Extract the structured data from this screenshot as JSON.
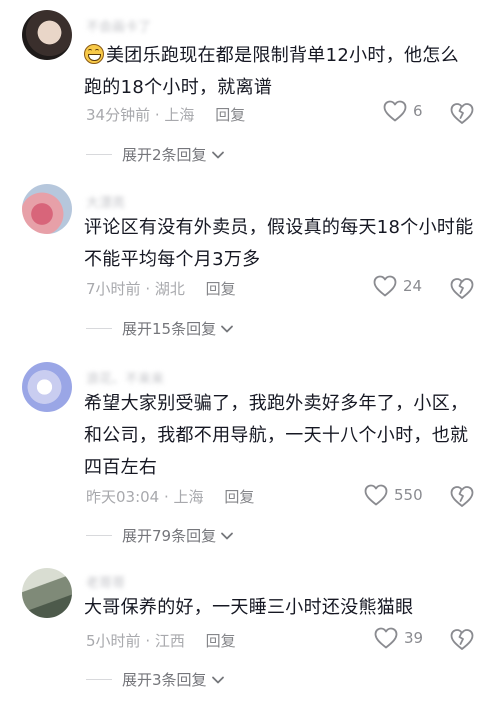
{
  "comments": [
    {
      "username": "不会画卡了",
      "has_emoji": true,
      "text_line1": "美团乐跑现在都是限制背单12小时，他怎么",
      "text_line2": "跑的18个小时，就离谱",
      "text_line3": "",
      "time": "34分钟前",
      "location": "上海",
      "reply_label": "回复",
      "likes": "6",
      "expand_label": "展开2条回复"
    },
    {
      "username": "大漂亮",
      "has_emoji": false,
      "text_line1": "评论区有没有外卖员，假设真的每天18个小时能",
      "text_line2": "不能平均每个月3万多",
      "text_line3": "",
      "time": "7小时前",
      "location": "湖北",
      "reply_label": "回复",
      "likes": "24",
      "expand_label": "展开15条回复"
    },
    {
      "username": "浪花、不来来",
      "has_emoji": false,
      "text_line1": "希望大家别受骗了，我跑外卖好多年了，小区，",
      "text_line2": "和公司，我都不用导航，一天十八个小时，也就",
      "text_line3": "四百左右",
      "time": "昨天03:04",
      "location": "上海",
      "reply_label": "回复",
      "likes": "550",
      "expand_label": "展开79条回复"
    },
    {
      "username": "老哥哥",
      "has_emoji": false,
      "text_line1": "大哥保养的好，一天睡三小时还没熊猫眼",
      "text_line2": "",
      "text_line3": "",
      "time": "5小时前",
      "location": "江西",
      "reply_label": "回复",
      "likes": "39",
      "expand_label": "展开3条回复"
    }
  ],
  "colors": {
    "text": "#161823",
    "meta": "#a8a9ad",
    "icon": "#8a8b90"
  }
}
